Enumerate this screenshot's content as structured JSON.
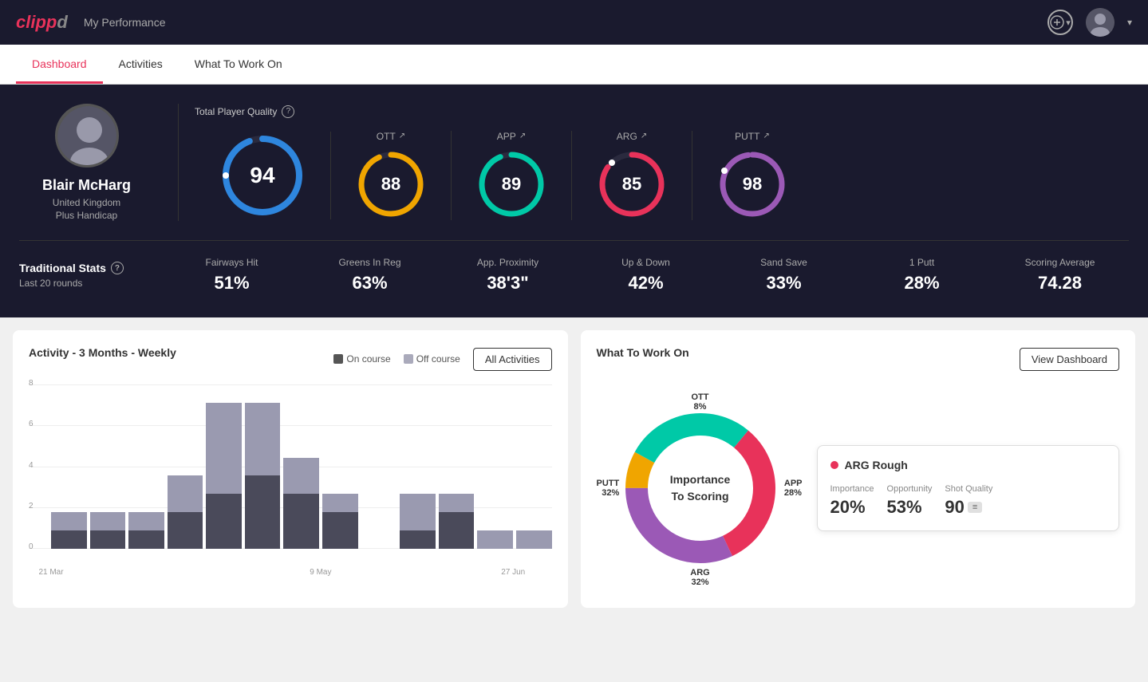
{
  "app": {
    "logo": "clippd",
    "logo_color": "clip",
    "header_title": "My Performance"
  },
  "tabs": [
    {
      "id": "dashboard",
      "label": "Dashboard",
      "active": true
    },
    {
      "id": "activities",
      "label": "Activities",
      "active": false
    },
    {
      "id": "what-to-work-on",
      "label": "What To Work On",
      "active": false
    }
  ],
  "player": {
    "name": "Blair McHarg",
    "country": "United Kingdom",
    "handicap": "Plus Handicap"
  },
  "tpq": {
    "label": "Total Player Quality",
    "value": 94,
    "color": "#2e86de"
  },
  "scores": [
    {
      "id": "ott",
      "label": "OTT",
      "value": 88,
      "color": "#f0a500",
      "bg_color": "#2a2a3e"
    },
    {
      "id": "app",
      "label": "APP",
      "value": 89,
      "color": "#00c9a7",
      "bg_color": "#2a2a3e"
    },
    {
      "id": "arg",
      "label": "ARG",
      "value": 85,
      "color": "#e8325a",
      "bg_color": "#2a2a3e"
    },
    {
      "id": "putt",
      "label": "PUTT",
      "value": 98,
      "color": "#9b59b6",
      "bg_color": "#2a2a3e"
    }
  ],
  "traditional_stats": {
    "title": "Traditional Stats",
    "subtitle": "Last 20 rounds",
    "items": [
      {
        "label": "Fairways Hit",
        "value": "51%"
      },
      {
        "label": "Greens In Reg",
        "value": "63%"
      },
      {
        "label": "App. Proximity",
        "value": "38'3\""
      },
      {
        "label": "Up & Down",
        "value": "42%"
      },
      {
        "label": "Sand Save",
        "value": "33%"
      },
      {
        "label": "1 Putt",
        "value": "28%"
      },
      {
        "label": "Scoring Average",
        "value": "74.28"
      }
    ]
  },
  "activity_chart": {
    "title": "Activity - 3 Months - Weekly",
    "legend": {
      "on_course": "On course",
      "off_course": "Off course"
    },
    "all_activities_btn": "All Activities",
    "y_labels": [
      "8",
      "6",
      "4",
      "2",
      "0"
    ],
    "x_labels": [
      "21 Mar",
      "",
      "9 May",
      "",
      "27 Jun"
    ],
    "bars": [
      {
        "on": 1,
        "off": 1
      },
      {
        "on": 1,
        "off": 1
      },
      {
        "on": 1,
        "off": 1
      },
      {
        "on": 2,
        "off": 2
      },
      {
        "on": 3,
        "off": 5
      },
      {
        "on": 4,
        "off": 4
      },
      {
        "on": 3,
        "off": 2
      },
      {
        "on": 2,
        "off": 1
      },
      {
        "on": 0,
        "off": 0
      },
      {
        "on": 1,
        "off": 2
      },
      {
        "on": 2,
        "off": 1
      },
      {
        "on": 0,
        "off": 1
      },
      {
        "on": 0,
        "off": 1
      }
    ]
  },
  "what_to_work_on": {
    "title": "What To Work On",
    "view_dashboard_btn": "View Dashboard",
    "donut_center_line1": "Importance",
    "donut_center_line2": "To Scoring",
    "segments": [
      {
        "id": "ott",
        "label": "OTT",
        "pct": "8%",
        "value": 8,
        "color": "#f0a500"
      },
      {
        "id": "app",
        "label": "APP",
        "pct": "28%",
        "value": 28,
        "color": "#00c9a7"
      },
      {
        "id": "arg",
        "label": "ARG",
        "pct": "32%",
        "value": 32,
        "color": "#e8325a"
      },
      {
        "id": "putt",
        "label": "PUTT",
        "pct": "32%",
        "value": 32,
        "color": "#9b59b6"
      }
    ],
    "info_card": {
      "title": "ARG Rough",
      "importance_label": "Importance",
      "importance_value": "20%",
      "opportunity_label": "Opportunity",
      "opportunity_value": "53%",
      "shot_quality_label": "Shot Quality",
      "shot_quality_value": "90"
    }
  }
}
